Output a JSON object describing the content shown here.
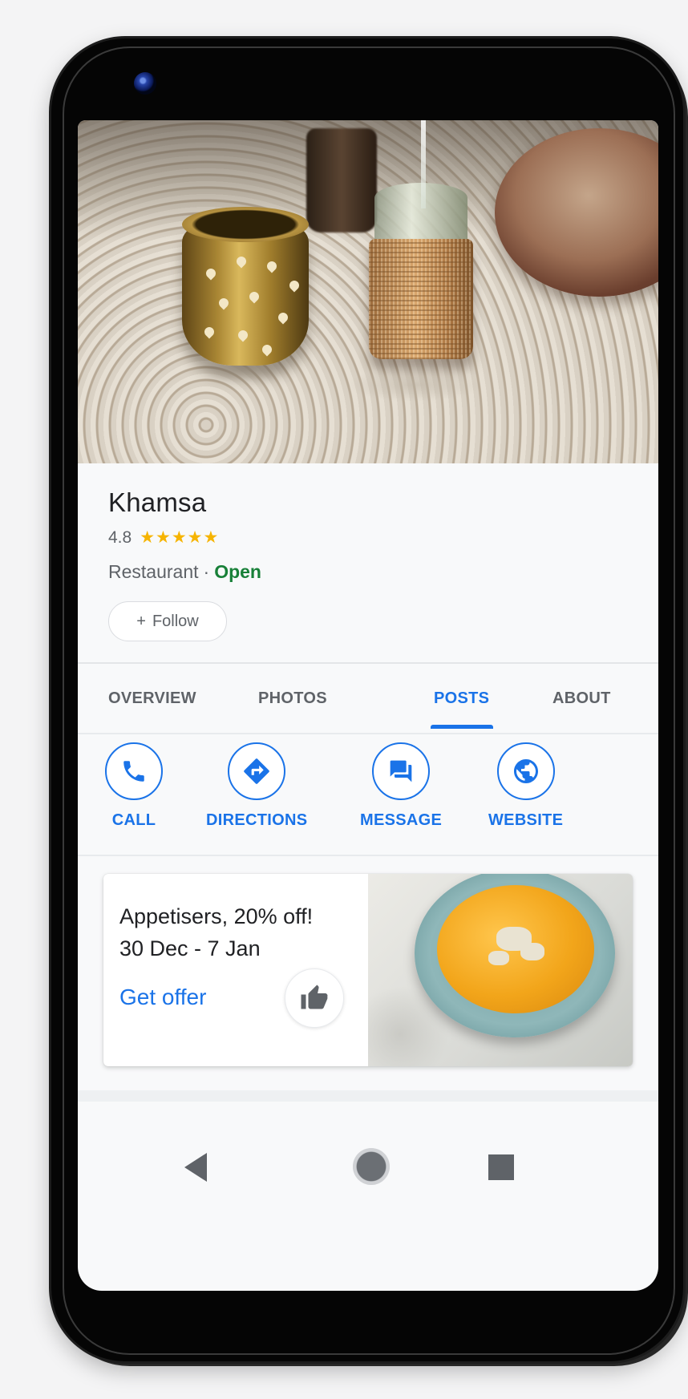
{
  "place": {
    "name": "Khamsa",
    "rating": "4.8",
    "rating_value": 4.8,
    "stars": "★★★★★",
    "category": "Restaurant",
    "separator": "·",
    "status": "Open",
    "follow_label": "Follow",
    "follow_icon": "+"
  },
  "tabs": [
    {
      "label": "OVERVIEW",
      "active": false
    },
    {
      "label": "PHOTOS",
      "active": false
    },
    {
      "label": "POSTS",
      "active": true
    },
    {
      "label": "ABOUT",
      "active": false
    }
  ],
  "actions": [
    {
      "label": "CALL",
      "icon": "phone-icon"
    },
    {
      "label": "DIRECTIONS",
      "icon": "directions-icon"
    },
    {
      "label": "MESSAGE",
      "icon": "message-icon"
    },
    {
      "label": "WEBSITE",
      "icon": "globe-icon"
    }
  ],
  "post": {
    "title": "Appetisers, 20% off!",
    "dates": "30 Dec - 7 Jan",
    "cta": "Get offer",
    "like_icon": "thumbs-up-icon"
  },
  "colors": {
    "accent": "#1a73e8",
    "open_status": "#188038",
    "stars": "#f6b400",
    "text_primary": "#202124",
    "text_secondary": "#5f6368"
  }
}
